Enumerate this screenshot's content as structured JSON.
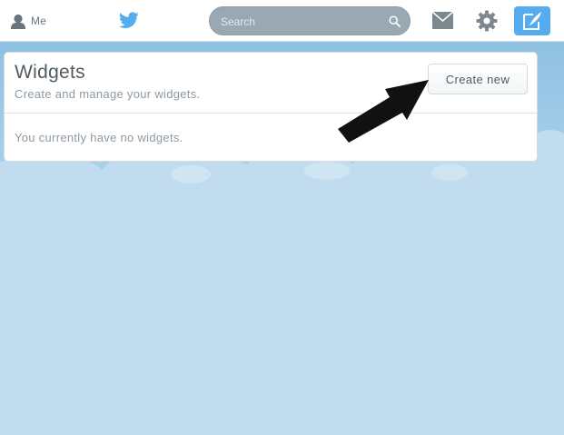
{
  "topbar": {
    "me_label": "Me",
    "search_placeholder": "Search",
    "icons": {
      "me": "user-icon",
      "logo": "twitter-bird-icon",
      "search": "magnifier-icon",
      "messages": "envelope-icon",
      "settings": "gear-icon",
      "compose": "compose-tweet-icon"
    }
  },
  "widgets": {
    "title": "Widgets",
    "subtitle": "Create and manage your widgets.",
    "create_label": "Create new",
    "empty_message": "You currently have no widgets."
  },
  "colors": {
    "accent": "#55acee",
    "background": "#c0dcee",
    "search_bg": "#9aa8b3",
    "text_muted": "#8d99a3"
  }
}
